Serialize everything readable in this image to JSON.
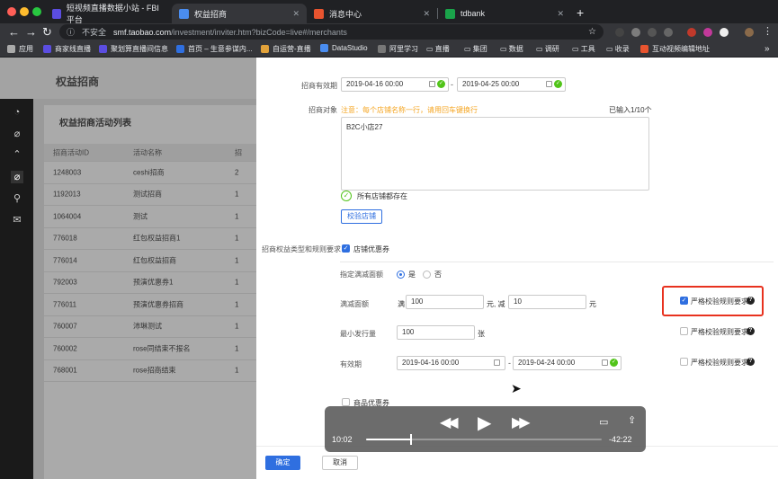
{
  "browser": {
    "tabs": [
      {
        "title": "短视频直播数据小站 - FBI平台",
        "favicon_color": "#5b4de0"
      },
      {
        "title": "权益招商",
        "favicon_color": "#4a8df0",
        "active": true
      },
      {
        "title": "消息中心",
        "favicon_color": "#e8542f"
      },
      {
        "title": "tdbank",
        "favicon_color": "#1aa34a"
      }
    ],
    "security_label": "不安全",
    "url_host": "smf.taobao.com",
    "url_path": "/investment/inviter.htm?bizCode=live#/merchants",
    "bookmarks": [
      "应用",
      "商家线直播",
      "聚划算直播间信息",
      "首页 – 生意参谋内...",
      "自运营-直播",
      "DataStudio",
      "阿里学习",
      "直播",
      "集团",
      "数据",
      "调研",
      "工具",
      "收录",
      "互动视频编辑地址"
    ]
  },
  "background_page": {
    "title": "权益招商",
    "card_title": "权益招商活动列表",
    "table": {
      "headers": [
        "招商活动ID",
        "活动名称",
        "招"
      ],
      "rows": [
        [
          "1248003",
          "ceshi招商",
          "2"
        ],
        [
          "1192013",
          "测试招商",
          "1"
        ],
        [
          "1064004",
          "测试",
          "1"
        ],
        [
          "776018",
          "红包权益招商1",
          "1"
        ],
        [
          "776014",
          "红包权益招商",
          "1"
        ],
        [
          "792003",
          "预演优惠券1",
          "1"
        ],
        [
          "776011",
          "预演优惠券招商",
          "1"
        ],
        [
          "760007",
          "沛琳测试",
          "1"
        ],
        [
          "760002",
          "rose同结束不报名",
          "1"
        ],
        [
          "768001",
          "rose招商结束",
          "1"
        ]
      ]
    }
  },
  "form": {
    "period_label": "招商有效期",
    "period_start": "2019-04-16 00:00",
    "period_end": "2019-04-25 00:00",
    "target_label": "招商对象",
    "target_note": "注意：每个店铺名称一行，请用回车键换行",
    "target_count": "已输入1/10个",
    "target_value": "B2C小店27",
    "all_exist": "所有店铺都存在",
    "verify_button": "校验店铺",
    "rights_label": "招商权益类型和规则要求",
    "coupon_label": "店铺优惠券",
    "specify_label": "指定满减面额",
    "opt_yes": "是",
    "opt_no": "否",
    "threshold_label": "满减面额",
    "full_prefix": "满",
    "full_amount": "100",
    "yuan_minus": "元, 减",
    "discount_amount": "10",
    "yuan": "元",
    "min_issue_label": "最小发行量",
    "min_issue_value": "100",
    "unit_zhang": "张",
    "validity_label": "有效期",
    "validity_start": "2019-04-16 00:00",
    "validity_end": "2019-04-24 00:00",
    "strict_label": "严格校验规则要求",
    "strict_checked": [
      true,
      false,
      false
    ],
    "goods_coupon_label": "商品优惠券",
    "confirm_button": "确定",
    "cancel_button": "取消"
  },
  "player": {
    "elapsed": "10:02",
    "remaining": "-42:22",
    "progress": 0.19
  }
}
